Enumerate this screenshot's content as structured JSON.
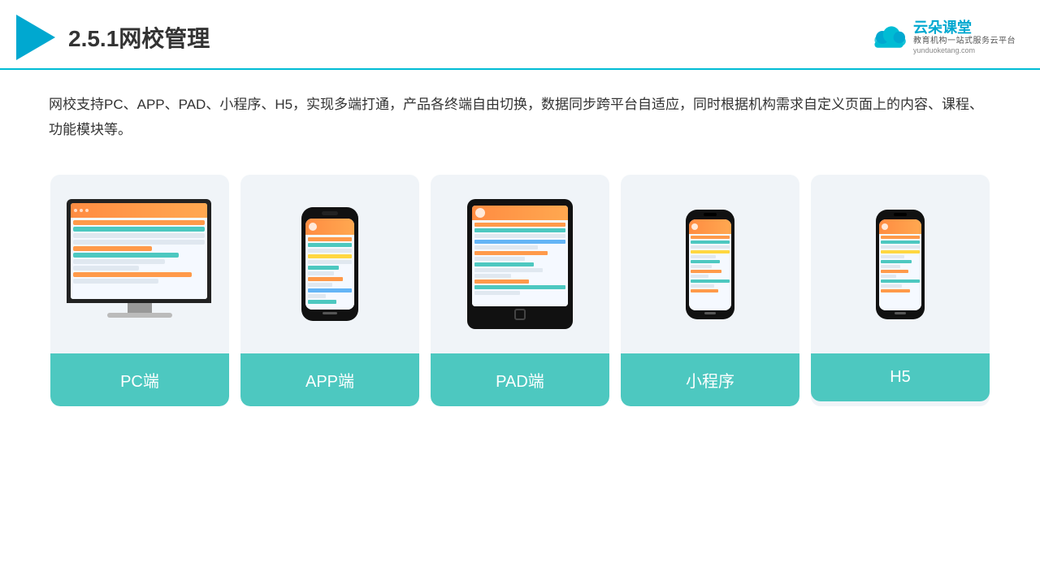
{
  "header": {
    "title": "2.5.1网校管理",
    "brand_name": "云朵课堂",
    "brand_sub": "教育机构一站式服务云平台",
    "brand_url": "yunduoketang.com"
  },
  "description": {
    "text": "网校支持PC、APP、PAD、小程序、H5，实现多端打通，产品各终端自由切换，数据同步跨平台自适应，同时根据机构需求自定义页面上的内容、课程、功能模块等。"
  },
  "cards": [
    {
      "id": "pc",
      "label": "PC端"
    },
    {
      "id": "app",
      "label": "APP端"
    },
    {
      "id": "pad",
      "label": "PAD端"
    },
    {
      "id": "miniprogram",
      "label": "小程序"
    },
    {
      "id": "h5",
      "label": "H5"
    }
  ]
}
